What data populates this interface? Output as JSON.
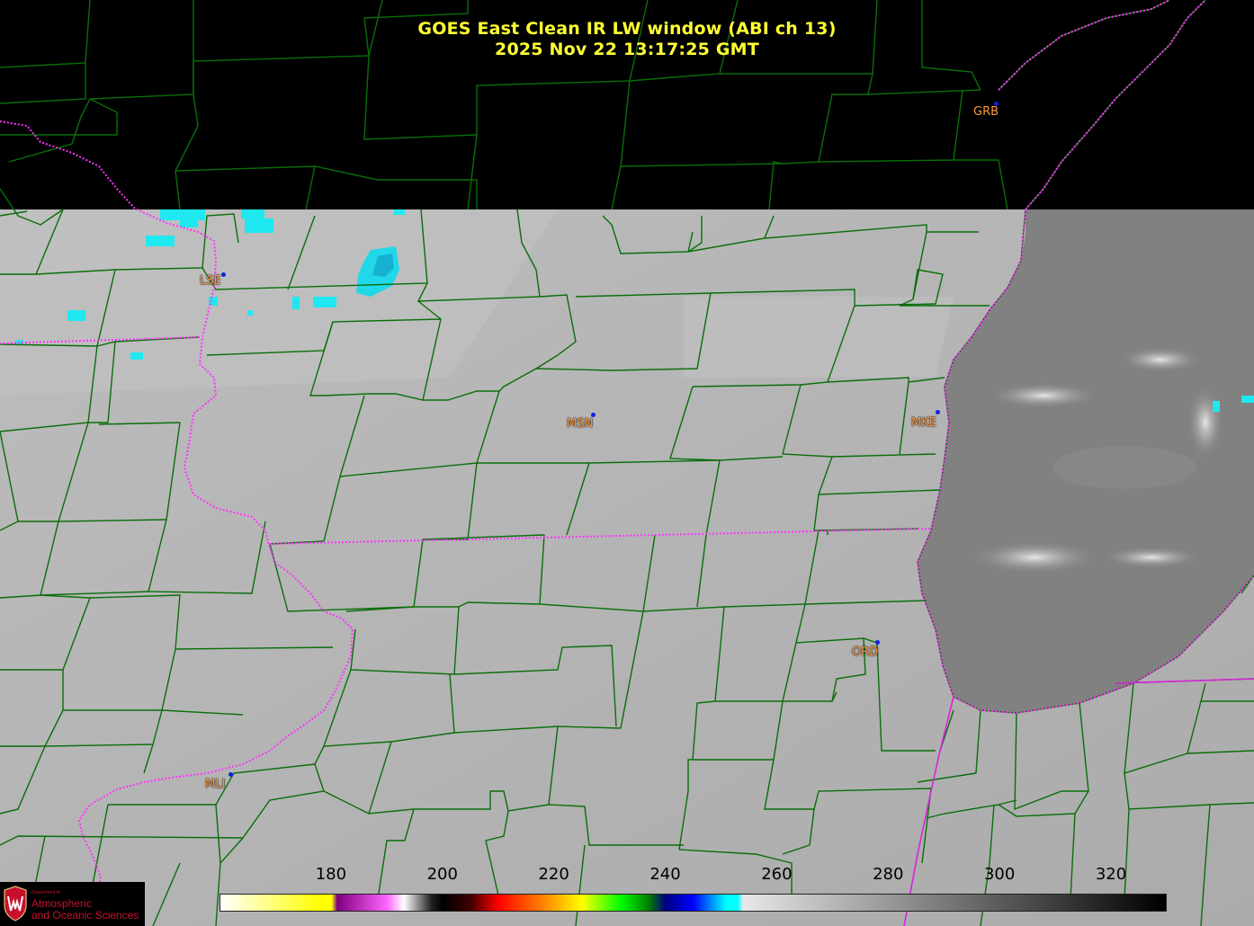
{
  "title": {
    "line1": "GOES East Clean IR LW window (ABI ch 13)",
    "line2": "2025 Nov 22  13:17:25 GMT"
  },
  "stations": [
    {
      "id": "GRB",
      "label": "GRB"
    },
    {
      "id": "LSE",
      "label": "LSE"
    },
    {
      "id": "MSN",
      "label": "MSN"
    },
    {
      "id": "MKE",
      "label": "MKE"
    },
    {
      "id": "ORD",
      "label": "ORD"
    },
    {
      "id": "MLI",
      "label": "MLI"
    }
  ],
  "colorbar": {
    "min": 160,
    "max": 330,
    "ticks": [
      "180",
      "200",
      "220",
      "240",
      "260",
      "280",
      "300",
      "320"
    ],
    "tick_values": [
      180,
      200,
      220,
      240,
      260,
      280,
      300,
      320
    ],
    "stops": [
      {
        "value": 160,
        "color": "#ffffff"
      },
      {
        "value": 178,
        "color": "#ffff00"
      },
      {
        "value": 180,
        "color": "#ffff00"
      },
      {
        "value": 181,
        "color": "#800080"
      },
      {
        "value": 190,
        "color": "#ff66ff"
      },
      {
        "value": 193,
        "color": "#ffffff"
      },
      {
        "value": 198,
        "color": "#202020"
      },
      {
        "value": 200,
        "color": "#000000"
      },
      {
        "value": 205,
        "color": "#400000"
      },
      {
        "value": 210,
        "color": "#ff0000"
      },
      {
        "value": 220,
        "color": "#ffa500"
      },
      {
        "value": 225,
        "color": "#ffff00"
      },
      {
        "value": 232,
        "color": "#00ff00"
      },
      {
        "value": 237,
        "color": "#008000"
      },
      {
        "value": 240,
        "color": "#000080"
      },
      {
        "value": 245,
        "color": "#0000ff"
      },
      {
        "value": 251,
        "color": "#00ffff"
      },
      {
        "value": 253,
        "color": "#00ffff"
      },
      {
        "value": 254,
        "color": "#e8e8e8"
      },
      {
        "value": 330,
        "color": "#000000"
      }
    ]
  },
  "logo": {
    "dept": "Department of",
    "line1": "Atmospheric",
    "line2": "and Oceanic Sciences"
  },
  "colors": {
    "county_lines": "#0a6e0a",
    "state_lines": "#ff33ff",
    "land": "#b4b4b4",
    "lake": "#808080",
    "title": "#ffff33",
    "station_label": "#ff9a3c",
    "station_dot": "#1020e0",
    "cold_cloud": "#20e8f0"
  }
}
